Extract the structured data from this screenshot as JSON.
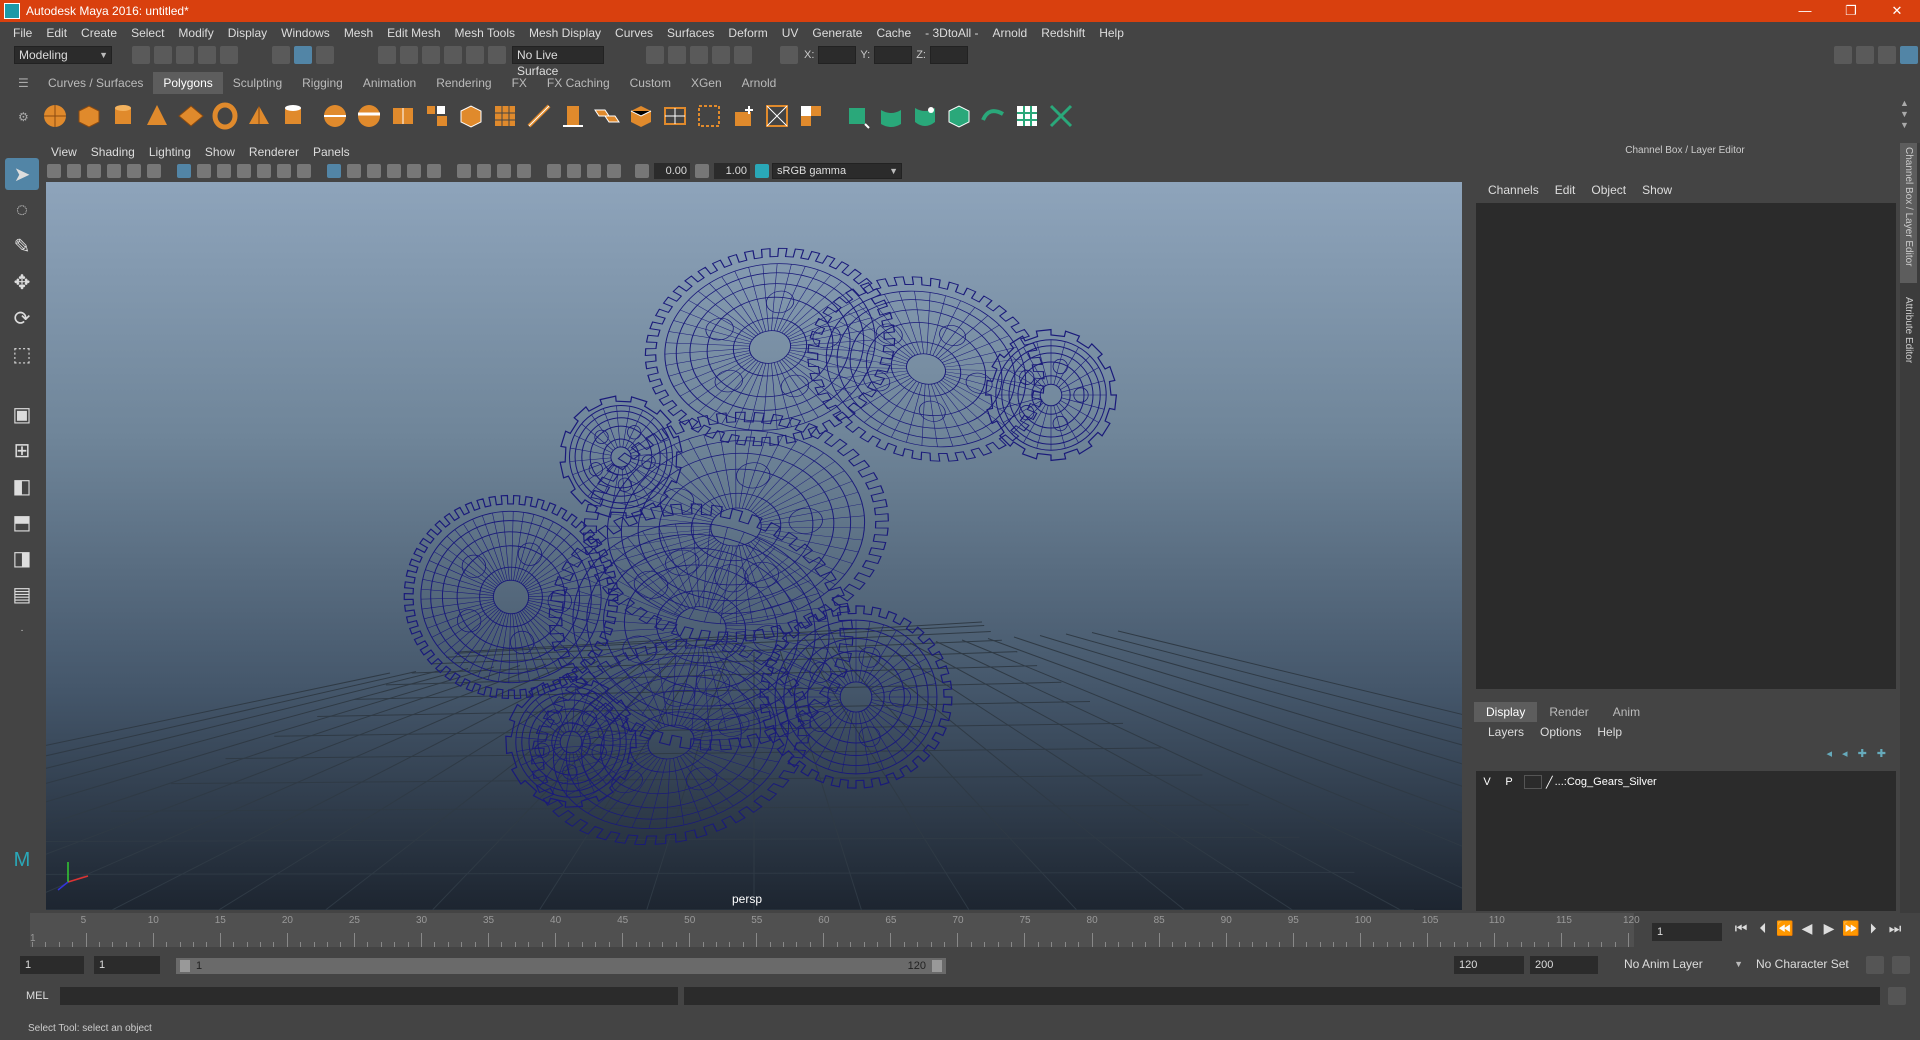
{
  "titlebar": {
    "title": "Autodesk Maya 2016: untitled*",
    "minimize": "—",
    "maximize": "❐",
    "close": "✕"
  },
  "menubar": [
    "File",
    "Edit",
    "Create",
    "Select",
    "Modify",
    "Display",
    "Windows",
    "Mesh",
    "Edit Mesh",
    "Mesh Tools",
    "Mesh Display",
    "Curves",
    "Surfaces",
    "Deform",
    "UV",
    "Generate",
    "Cache",
    "- 3DtoAll -",
    "Arnold",
    "Redshift",
    "Help"
  ],
  "statusline": {
    "mode": "Modeling",
    "live_surface": "No Live Surface",
    "x_label": "X:",
    "y_label": "Y:",
    "z_label": "Z:"
  },
  "shelf": {
    "tabs": [
      "Curves / Surfaces",
      "Polygons",
      "Sculpting",
      "Rigging",
      "Animation",
      "Rendering",
      "FX",
      "FX Caching",
      "Custom",
      "XGen",
      "Arnold"
    ],
    "active_tab": "Polygons"
  },
  "viewport": {
    "menu": [
      "View",
      "Shading",
      "Lighting",
      "Show",
      "Renderer",
      "Panels"
    ],
    "exposure": "0.00",
    "gamma": "1.00",
    "color_space": "sRGB gamma",
    "camera_label": "persp",
    "wire_color": "#1a1a7a"
  },
  "channel_box": {
    "header": "Channel Box / Layer Editor",
    "menu": [
      "Channels",
      "Edit",
      "Object",
      "Show"
    ]
  },
  "layer_editor": {
    "tabs": [
      "Display",
      "Render",
      "Anim"
    ],
    "active_tab": "Display",
    "menu": [
      "Layers",
      "Options",
      "Help"
    ],
    "layers": [
      {
        "v": "V",
        "p": "P",
        "name": "...:Cog_Gears_Silver"
      }
    ]
  },
  "side_tabs": [
    "Channel Box / Layer Editor",
    "Attribute Editor"
  ],
  "timeline": {
    "ticks": [
      "5",
      "10",
      "15",
      "20",
      "25",
      "30",
      "35",
      "40",
      "45",
      "50",
      "55",
      "60",
      "65",
      "70",
      "75",
      "80",
      "85",
      "90",
      "95",
      "100",
      "105",
      "110",
      "115",
      "120"
    ],
    "start_label": "1",
    "current_frame": "1"
  },
  "range": {
    "start": "1",
    "anim_start": "1",
    "slider_start": "1",
    "slider_end": "120",
    "anim_end": "120",
    "end": "200",
    "anim_layer": "No Anim Layer",
    "character_set": "No Character Set"
  },
  "cmdline": {
    "label": "MEL"
  },
  "helpline": {
    "text": "Select Tool: select an object"
  }
}
